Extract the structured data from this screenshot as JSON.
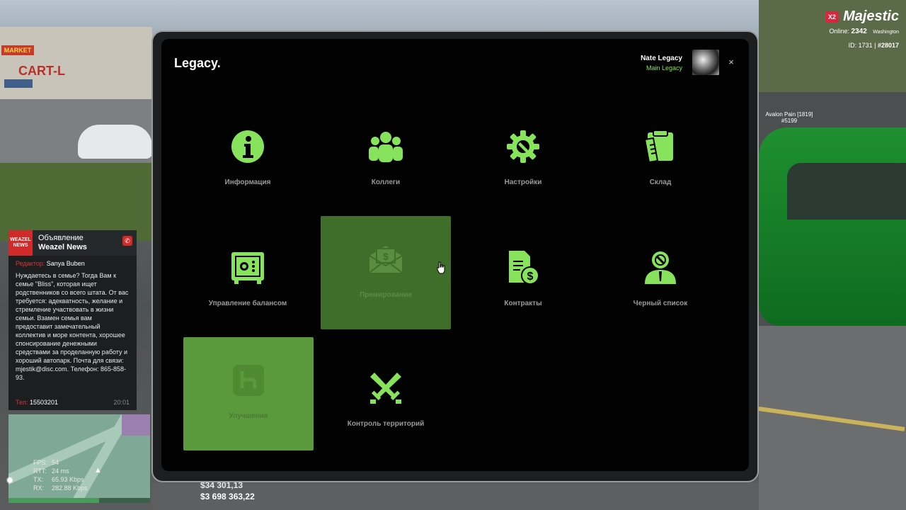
{
  "hud": {
    "badge": "X2",
    "brand": "Majestic",
    "online_label": "Online:",
    "online_count": "2342",
    "server": "Washington",
    "id_label": "ID: 1731 |",
    "id_value": "#28017",
    "player_tag": "Avalon Pain [1819] #5199",
    "money_cash": "$34 301,13",
    "money_bank": "$3 698 363,22"
  },
  "news": {
    "logo": "WEAZEL NEWS",
    "title": "Объявление",
    "source": "Weazel News",
    "editor_label": "Редактор:",
    "editor_name": "Sanya Buben",
    "body": "Нуждаетесь в семье? Тогда Вам к семье \"Bliss\", которая ищет родственников со всего штата. От вас требуется: адекватность, желание и стремление участвовать в жизни семьи. Взамен семья вам предоставит замечательный коллектив и море контента, хорошее спонсирование денежными средствами за проделанную работу и хороший автопарк. Почта для связи: mjestik@disc.com. Телефон: 865-858-93.",
    "phone_label": "Тел:",
    "phone": "15503201",
    "time": "20:01"
  },
  "net": {
    "fps_label": "FPS:",
    "fps": "54",
    "rtt_label": "RTT:",
    "rtt": "24 ms",
    "tx_label": "TX:",
    "tx": "65.93 Kbps",
    "rx_label": "RX:",
    "rx": "282.88 Kbps"
  },
  "tablet": {
    "title": "Legacy.",
    "user_name": "Nate Legacy",
    "user_role": "Main Legacy",
    "close": "×",
    "tiles": [
      {
        "label": "Информация",
        "icon": "info-icon"
      },
      {
        "label": "Коллеги",
        "icon": "users-icon"
      },
      {
        "label": "Настройки",
        "icon": "gear-icon"
      },
      {
        "label": "Склад",
        "icon": "clipboard-icon"
      },
      {
        "label": "Управление балансом",
        "icon": "safe-icon"
      },
      {
        "label": "Премирование",
        "icon": "envelope-money-icon"
      },
      {
        "label": "Контракты",
        "icon": "contract-icon"
      },
      {
        "label": "Черный список",
        "icon": "blacklist-user-icon"
      },
      {
        "label": "Улучшения",
        "icon": "upgrade-icon"
      },
      {
        "label": "Контроль территорий",
        "icon": "crossed-swords-icon"
      }
    ]
  },
  "colors": {
    "accent": "#86e35b",
    "tile_hover": "#3f6e2a",
    "tile_active": "#5a9a3c"
  }
}
